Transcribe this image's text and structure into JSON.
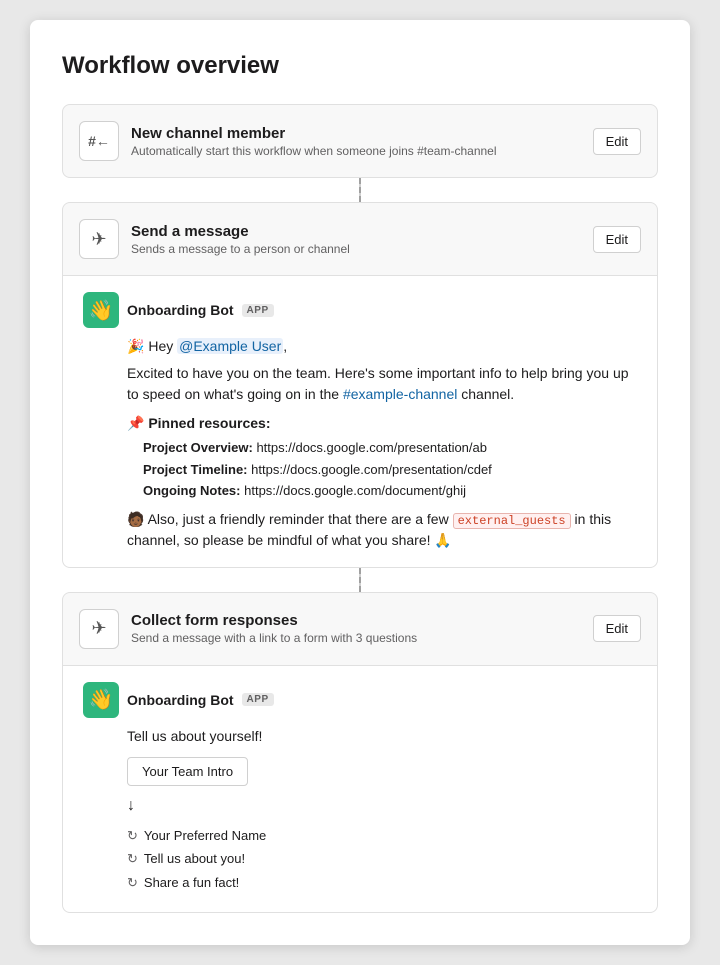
{
  "page": {
    "title": "Workflow overview"
  },
  "steps": [
    {
      "id": "new-channel-member",
      "icon": "#←",
      "title": "New channel member",
      "desc": "Automatically start this workflow when someone joins #team-channel",
      "has_edit": true,
      "edit_label": "Edit"
    },
    {
      "id": "send-message",
      "icon": "✈",
      "title": "Send a message",
      "desc": "Sends a message to a person or channel",
      "has_edit": true,
      "edit_label": "Edit"
    }
  ],
  "onboarding_message": {
    "bot_name": "Onboarding Bot",
    "app_badge": "APP",
    "greeting_emoji": "🎉",
    "greeting_text": " Hey ",
    "mention": "@Example User",
    "intro_text": "Excited to have you on the team. Here's some important info to help bring you up to speed on what's going on in the",
    "channel_link": "#example-channel",
    "channel_suffix": " channel.",
    "pinned_emoji": "📌",
    "pinned_title": " Pinned resources:",
    "pinned_items": [
      {
        "key": "Project Overview:",
        "value": " https://docs.google.com/presentation/ab"
      },
      {
        "key": "Project Timeline:",
        "value": " https://docs.google.com/presentation/cdef"
      },
      {
        "key": "Ongoing Notes:",
        "value": " https://docs.google.com/document/ghij"
      }
    ],
    "reminder_emoji": "🧑🏾",
    "reminder_text": " Also, just a friendly reminder that there are a few ",
    "external_badge": "external_guests",
    "reminder_suffix": " in this channel, so please be mindful of what you share! 🙏"
  },
  "collect_form": {
    "icon": "✈",
    "title": "Collect form responses",
    "desc": "Send a message with a link to a form with 3 questions",
    "has_edit": true,
    "edit_label": "Edit"
  },
  "form_message": {
    "bot_name": "Onboarding Bot",
    "app_badge": "APP",
    "body_text": "Tell us about yourself!",
    "button_label": "Your Team Intro",
    "arrow": "↓",
    "fields": [
      {
        "icon": "↺",
        "label": "Your Preferred Name"
      },
      {
        "icon": "↺",
        "label": "Tell us about you!"
      },
      {
        "icon": "↺",
        "label": "Share a fun fact!"
      }
    ]
  }
}
